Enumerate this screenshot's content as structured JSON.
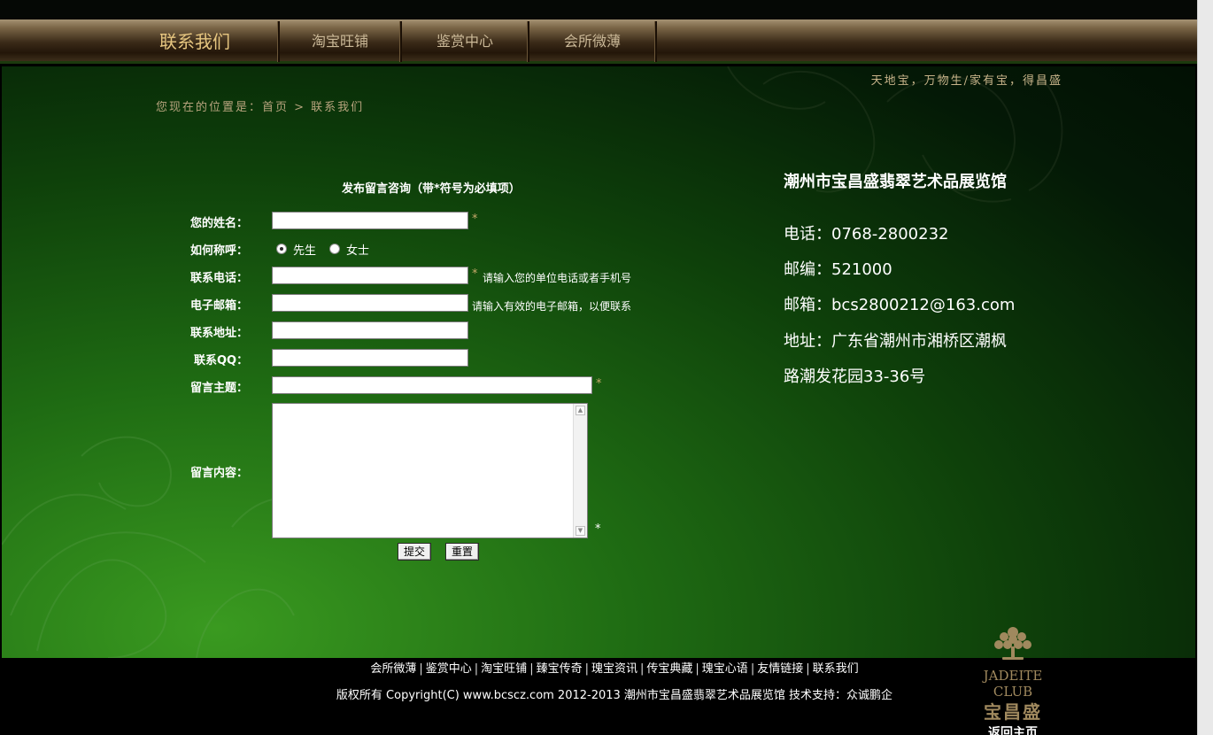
{
  "nav": {
    "items": [
      {
        "label": "联系我们",
        "active": true
      },
      {
        "label": "淘宝旺铺",
        "active": false
      },
      {
        "label": "鉴赏中心",
        "active": false
      },
      {
        "label": "会所微薄",
        "active": false
      }
    ]
  },
  "slogan": "天地宝，万物生/家有宝，得昌盛",
  "breadcrumb": "您现在的位置是：首页 > 联系我们",
  "form": {
    "title": "发布留言咨询（带*符号为必填项）",
    "name_label": "您的姓名：",
    "salutation_label": "如何称呼：",
    "salutation_options": [
      "先生",
      "女士"
    ],
    "salutation_selected": "先生",
    "phone_label": "联系电话：",
    "phone_hint": "请输入您的单位电话或者手机号",
    "email_label": "电子邮箱：",
    "email_hint": "请输入有效的电子邮箱，以便联系",
    "address_label": "联系地址：",
    "qq_label": "联系QQ：",
    "subject_label": "留言主题：",
    "content_label": "留言内容：",
    "required_mark": "*",
    "submit_label": "提交",
    "reset_label": "重置"
  },
  "info": {
    "title": "潮州市宝昌盛翡翠艺术品展览馆",
    "phone": "电话：0768-2800232",
    "postcode": "邮编：521000",
    "email": "邮箱：bcs2800212@163.com",
    "address_line1": "地址：广东省潮州市湘桥区潮枫",
    "address_line2": "路潮发花园33-36号"
  },
  "footer": {
    "links": [
      "会所微薄",
      "鉴赏中心",
      "淘宝旺铺",
      "臻宝传奇",
      "瑰宝资讯",
      "传宝典藏",
      "瑰宝心语",
      "友情链接",
      "联系我们"
    ],
    "separator": "|",
    "copyright": "版权所有 Copyright(C) www.bcscz.com 2012-2013 潮州市宝昌盛翡翠艺术品展览馆 技术支持：众诚鹏企"
  },
  "club": {
    "name_en": "JADEITE CLUB",
    "name_cn": "宝昌盛",
    "back_home": "返回主页"
  },
  "colors": {
    "nav_text": "#cbb998",
    "nav_active": "#e6c680",
    "accent_gold": "#c7a96a",
    "bg_green": "#1f6c13"
  }
}
